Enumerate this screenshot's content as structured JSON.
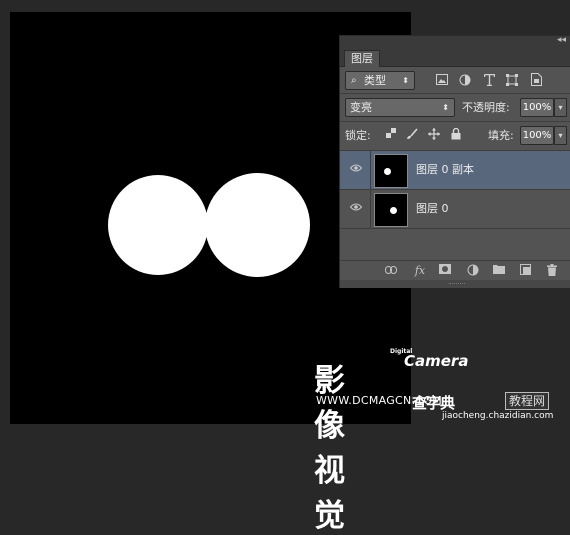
{
  "panel": {
    "tab": "图层",
    "collapse_glyph": "◂◂",
    "filter": {
      "icon": "⌕",
      "label": "类型",
      "arrow": "⬍"
    },
    "filter_icons": [
      "image-filter-icon",
      "adjustment-filter-icon",
      "type-filter-icon",
      "shape-filter-icon",
      "smart-object-filter-icon"
    ],
    "blend_mode": "变亮",
    "opacity_label": "不透明度:",
    "opacity_value": "100%",
    "lock_label": "锁定:",
    "fill_label": "填充:",
    "fill_value": "100%",
    "layers": [
      {
        "name": "图层 0 副本",
        "selected": true,
        "visible": true
      },
      {
        "name": "图层 0",
        "selected": false,
        "visible": true
      }
    ]
  },
  "watermark": {
    "digital": "Digital",
    "camera": "Camera",
    "chinese": "影像视觉",
    "url": "WWW.DCMAGCN.COM",
    "site_logo": "查字典",
    "site_tag": "教程网",
    "site_url": "jiaocheng.chazidian.com"
  }
}
